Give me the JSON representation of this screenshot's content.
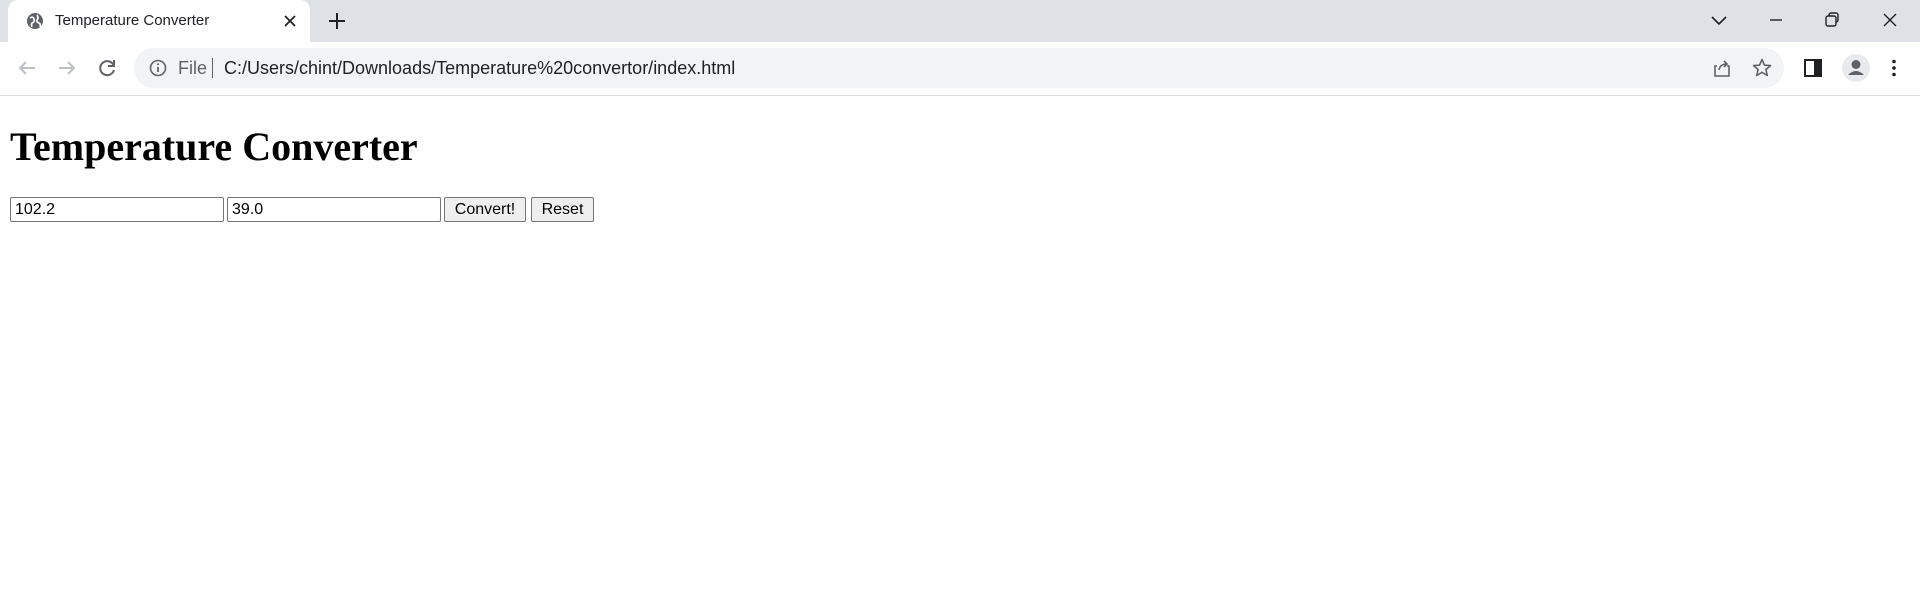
{
  "browser": {
    "tab": {
      "title": "Temperature Converter",
      "favicon": "globe-icon"
    },
    "address_bar": {
      "scheme": "File",
      "url": "C:/Users/chint/Downloads/Temperature%20convertor/index.html"
    },
    "icons": {
      "back": "arrow-left-icon",
      "forward": "arrow-right-icon",
      "reload": "reload-icon",
      "info": "info-icon",
      "share": "share-icon",
      "bookmark": "star-icon",
      "side_panel": "side-panel-icon",
      "profile": "profile-icon",
      "menu": "kebab-menu-icon",
      "tab_search": "chevron-down-icon",
      "minimize": "minimize-icon",
      "restore": "restore-icon",
      "close": "close-icon",
      "new_tab": "plus-icon"
    }
  },
  "page": {
    "title": "Temperature Converter",
    "fahrenheit_value": "102.2",
    "celsius_value": "39.0",
    "convert_label": "Convert!",
    "reset_label": "Reset"
  }
}
